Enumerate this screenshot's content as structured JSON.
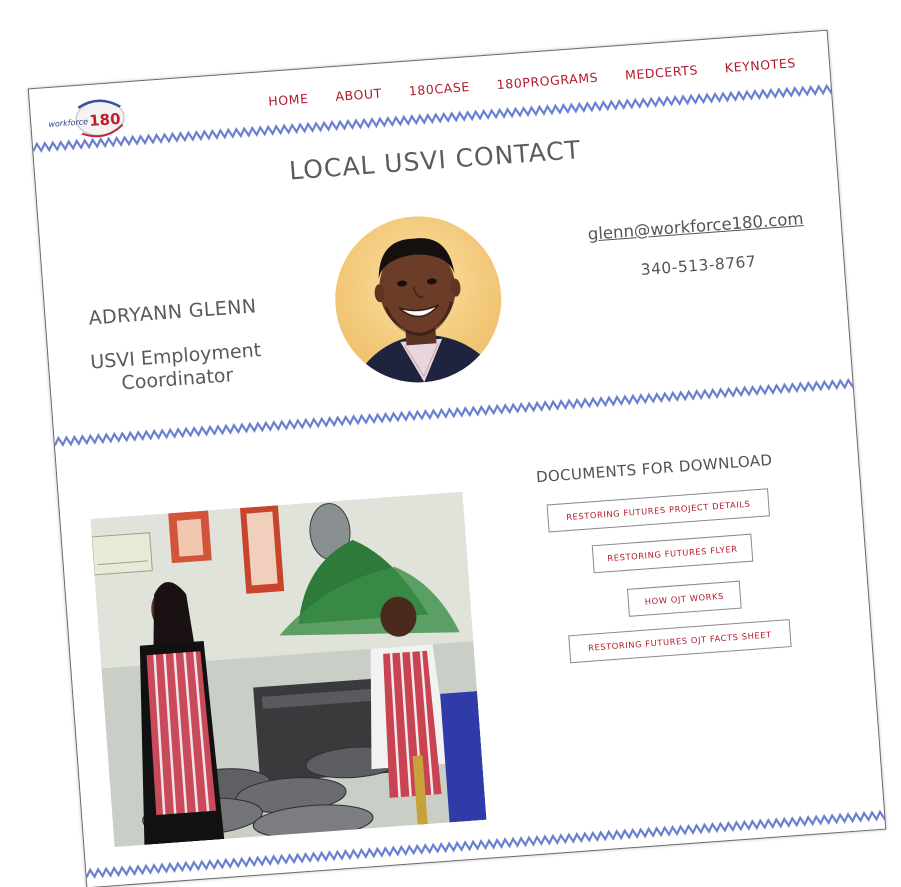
{
  "header": {
    "logo": {
      "prefix": "workforce",
      "number": "180"
    },
    "nav": [
      "HOME",
      "ABOUT",
      "180CASE",
      "180PROGRAMS",
      "MEDCERTS",
      "KEYNOTES"
    ]
  },
  "contact": {
    "title": "LOCAL USVI CONTACT",
    "name": "ADRYANN GLENN",
    "role_line1": "USVI Employment",
    "role_line2": "Coordinator",
    "email": "glenn@workforce180.com",
    "phone": "340-513-8767"
  },
  "documents": {
    "title": "DOCUMENTS FOR DOWNLOAD",
    "buttons": [
      "RESTORING FUTURES PROJECT DETAILS",
      "RESTORING FUTURES FLYER",
      "HOW OJT WORKS",
      "RESTORING FUTURES OJT FACTS SHEET"
    ]
  },
  "colors": {
    "accent": "#b3192b",
    "wave": "#6a7fd1",
    "text": "#5a5a5a"
  }
}
